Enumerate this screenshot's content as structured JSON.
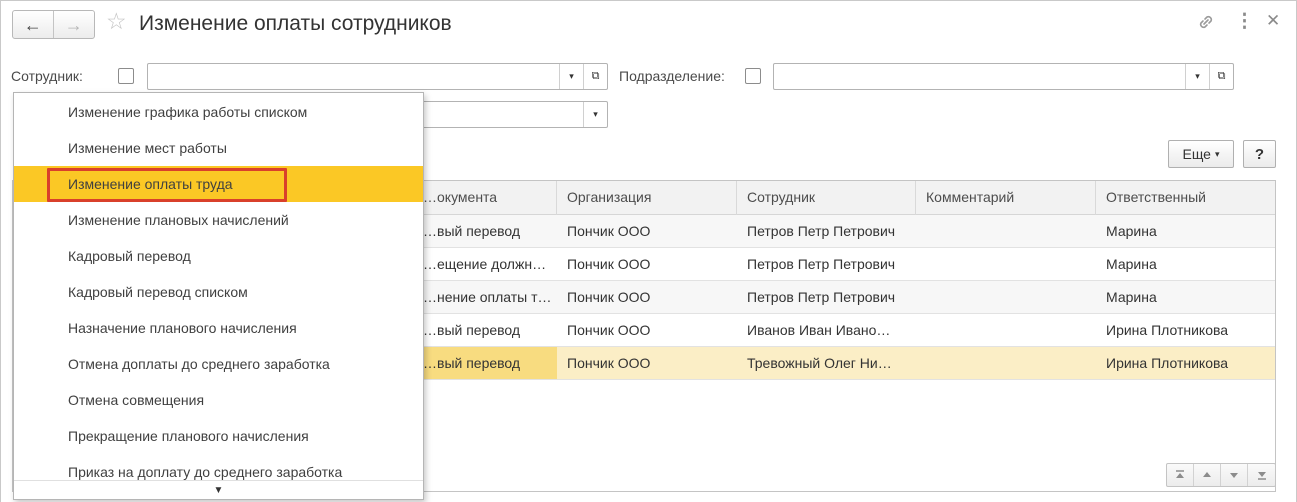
{
  "window": {
    "title": "Изменение оплаты сотрудников"
  },
  "filters": {
    "employee_label": "Сотрудник:",
    "department_label": "Подразделение:"
  },
  "toolbar": {
    "more_label": "Еще",
    "help_label": "?"
  },
  "table": {
    "columns": [
      "…окумента",
      "Организация",
      "Сотрудник",
      "Комментарий",
      "Ответственный"
    ],
    "rows": [
      [
        "…вый перевод",
        "Пончик ООО",
        "Петров Петр Петрович",
        "",
        "Марина"
      ],
      [
        "…ещение должн…",
        "Пончик ООО",
        "Петров Петр Петрович",
        "",
        "Марина"
      ],
      [
        "…нение оплаты т…",
        "Пончик ООО",
        "Петров Петр Петрович",
        "",
        "Марина"
      ],
      [
        "…вый перевод",
        "Пончик ООО",
        "Иванов Иван Ивано…",
        "",
        "Ирина Плотникова"
      ],
      [
        "…вый перевод",
        "Пончик ООО",
        "Тревожный Олег Ни…",
        "",
        "Ирина Плотникова"
      ]
    ]
  },
  "dropdown": {
    "items": [
      "Изменение графика работы списком",
      "Изменение мест работы",
      "Изменение оплаты труда",
      "Изменение плановых начислений",
      "Кадровый перевод",
      "Кадровый перевод списком",
      "Назначение планового начисления",
      "Отмена доплаты до среднего заработка",
      "Отмена совмещения",
      "Прекращение планового начисления",
      "Приказ на доплату до среднего заработка"
    ],
    "highlighted_index": 2,
    "highlight_color": "#fbc825",
    "outline_color": "#d9402b"
  },
  "icons": {
    "back": "←",
    "forward": "→",
    "star": "☆",
    "link": "🔗",
    "more": "⋮",
    "close": "✕",
    "caret": "▾",
    "open": "⧉",
    "menu_down": "▼",
    "scroll_first": "⏫",
    "scroll_up": "▲",
    "scroll_down": "▼",
    "scroll_last": "⏬"
  }
}
